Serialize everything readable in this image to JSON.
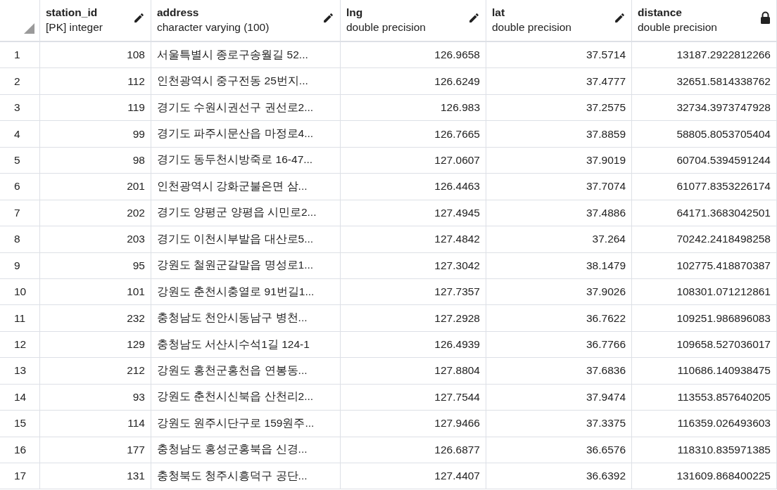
{
  "table": {
    "columns": [
      {
        "name": "station_id",
        "type": "[PK] integer",
        "editable": true,
        "kind": "number"
      },
      {
        "name": "address",
        "type": "character varying (100)",
        "editable": true,
        "kind": "text"
      },
      {
        "name": "lng",
        "type": "double precision",
        "editable": true,
        "kind": "number"
      },
      {
        "name": "lat",
        "type": "double precision",
        "editable": true,
        "kind": "number"
      },
      {
        "name": "distance",
        "type": "double precision",
        "editable": false,
        "kind": "number"
      }
    ],
    "rows": [
      {
        "number": "1",
        "cells": [
          "108",
          "서울특별시 종로구송월길 52...",
          "126.9658",
          "37.5714",
          "13187.2922812266"
        ]
      },
      {
        "number": "2",
        "cells": [
          "112",
          "인천광역시 중구전동 25번지...",
          "126.6249",
          "37.4777",
          "32651.5814338762"
        ]
      },
      {
        "number": "3",
        "cells": [
          "119",
          "경기도 수원시권선구 권선로2...",
          "126.983",
          "37.2575",
          "32734.3973747928"
        ]
      },
      {
        "number": "4",
        "cells": [
          "99",
          "경기도 파주시문산읍 마정로4...",
          "126.7665",
          "37.8859",
          "58805.8053705404"
        ]
      },
      {
        "number": "5",
        "cells": [
          "98",
          "경기도 동두천시방죽로 16-47...",
          "127.0607",
          "37.9019",
          "60704.5394591244"
        ]
      },
      {
        "number": "6",
        "cells": [
          "201",
          "인천광역시 강화군불은면 삼...",
          "126.4463",
          "37.7074",
          "61077.8353226174"
        ]
      },
      {
        "number": "7",
        "cells": [
          "202",
          "경기도 양평군 양평읍 시민로2...",
          "127.4945",
          "37.4886",
          "64171.3683042501"
        ]
      },
      {
        "number": "8",
        "cells": [
          "203",
          "경기도 이천시부발읍 대산로5...",
          "127.4842",
          "37.264",
          "70242.2418498258"
        ]
      },
      {
        "number": "9",
        "cells": [
          "95",
          "강원도 철원군갈말읍 명성로1...",
          "127.3042",
          "38.1479",
          "102775.418870387"
        ]
      },
      {
        "number": "10",
        "cells": [
          "101",
          "강원도 춘천시충열로 91번길1...",
          "127.7357",
          "37.9026",
          "108301.071212861"
        ]
      },
      {
        "number": "11",
        "cells": [
          "232",
          "충청남도 천안시동남구 병천...",
          "127.2928",
          "36.7622",
          "109251.986896083"
        ]
      },
      {
        "number": "12",
        "cells": [
          "129",
          "충청남도 서산시수석1길 124-1",
          "126.4939",
          "36.7766",
          "109658.527036017"
        ]
      },
      {
        "number": "13",
        "cells": [
          "212",
          "강원도 홍천군홍천읍 연봉동...",
          "127.8804",
          "37.6836",
          "110686.140938475"
        ]
      },
      {
        "number": "14",
        "cells": [
          "93",
          "강원도 춘천시신북읍 산천리2...",
          "127.7544",
          "37.9474",
          "113553.857640205"
        ]
      },
      {
        "number": "15",
        "cells": [
          "114",
          "강원도 원주시단구로 159원주...",
          "127.9466",
          "37.3375",
          "116359.026493603"
        ]
      },
      {
        "number": "16",
        "cells": [
          "177",
          "충청남도 홍성군홍북읍 신경...",
          "126.6877",
          "36.6576",
          "118310.835971385"
        ]
      },
      {
        "number": "17",
        "cells": [
          "131",
          "충청북도 청주시흥덕구 공단...",
          "127.4407",
          "36.6392",
          "131609.868400225"
        ]
      }
    ]
  }
}
